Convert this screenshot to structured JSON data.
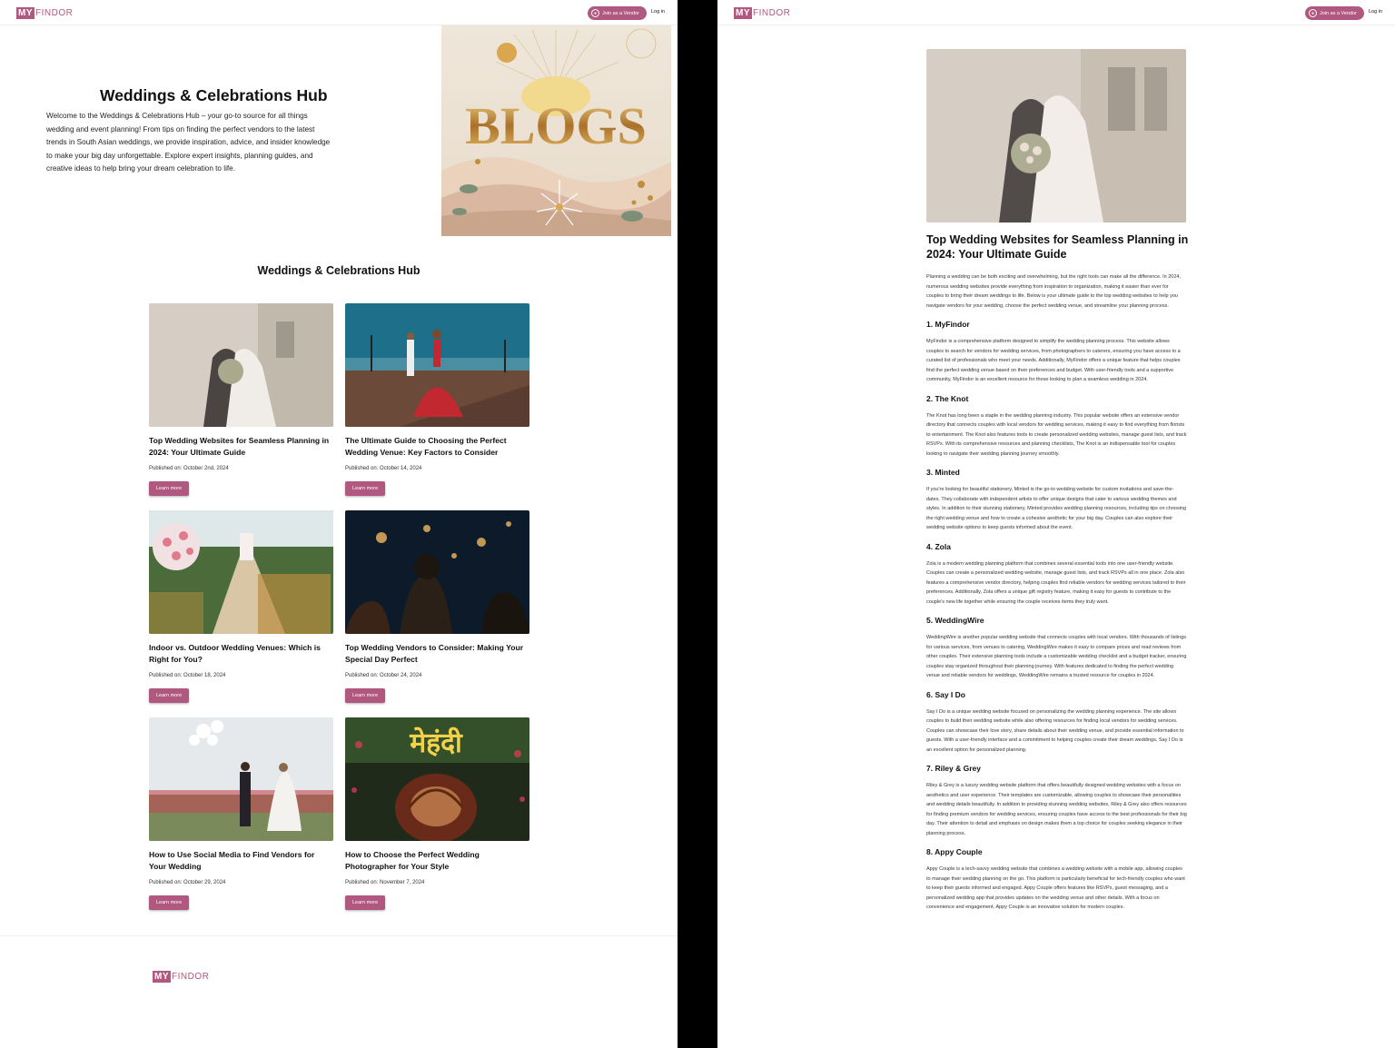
{
  "header": {
    "logo_my": "MY",
    "logo_rest": "FINDOR",
    "vendor_label": "Join as a Vendor",
    "login_label": "Log in"
  },
  "hero": {
    "title": "Weddings & Celebrations Hub",
    "text": "Welcome to the Weddings & Celebrations Hub – your go-to source for all things wedding and event planning! From tips on finding the perfect vendors to the latest trends in South Asian weddings, we provide inspiration, advice, and insider knowledge to make your big day unforgettable. Explore expert insights, planning guides, and creative ideas to help bring your dream celebration to life.",
    "image_word": "BLOGS"
  },
  "section_title": "Weddings & Celebrations Hub",
  "cards": [
    {
      "title": "Top Wedding Websites for Seamless Planning in 2024: Your Ultimate Guide",
      "published": "Published on: October 2nd, 2024",
      "button": "Learn more"
    },
    {
      "title": "The Ultimate Guide to Choosing the Perfect Wedding Venue: Key Factors to Consider",
      "published": "Published on: October 14, 2024",
      "button": "Learn more"
    },
    {
      "title": "Indoor vs. Outdoor Wedding Venues: Which is Right for You?",
      "published": "Published on: October 18, 2024",
      "button": "Learn more"
    },
    {
      "title": "Top Wedding Vendors to Consider: Making Your Special Day Perfect",
      "published": "Published on: October 24, 2024",
      "button": "Learn more"
    },
    {
      "title": "How to Use Social Media to Find Vendors for Your Wedding",
      "published": "Published on: October 29, 2024",
      "button": "Learn more"
    },
    {
      "title": "How to Choose the Perfect Wedding Photographer for Your Style",
      "published": "Published on: November 7, 2024",
      "button": "Learn more"
    }
  ],
  "article": {
    "title": "Top Wedding Websites for Seamless Planning in 2024: Your Ultimate Guide",
    "intro": "Planning a wedding can be both exciting and overwhelming, but the right tools can make all the difference. In 2024, numerous wedding websites provide everything from inspiration to organization, making it easier than ever for couples to bring their dream weddings to life. Below is your ultimate guide to the top wedding websites to help you navigate vendors for your wedding, choose the perfect wedding venue, and streamline your planning process.",
    "sections": [
      {
        "heading": "1. MyFindor",
        "body": "MyFindor is a comprehensive platform designed to simplify the wedding planning process. This website allows couples to search for vendors for wedding services, from photographers to caterers, ensuring you have access to a curated list of professionals who meet your needs. Additionally, MyFindor offers a unique feature that helps couples find the perfect wedding venue based on their preferences and budget. With user-friendly tools and a supportive community, MyFindor is an excellent resource for those looking to plan a seamless wedding in 2024."
      },
      {
        "heading": "2. The Knot",
        "body": "The Knot has long been a staple in the wedding planning industry. This popular website offers an extensive vendor directory that connects couples with local vendors for wedding services, making it easy to find everything from florists to entertainment. The Knot also features tools to create personalized wedding websites, manage guest lists, and track RSVPs. With its comprehensive resources and planning checklists, The Knot is an indispensable tool for couples looking to navigate their wedding planning journey smoothly."
      },
      {
        "heading": "3. Minted",
        "body": "If you're looking for beautiful stationery, Minted is the go-to wedding website for custom invitations and save-the-dates. They collaborate with independent artists to offer unique designs that cater to various wedding themes and styles. In addition to their stunning stationery, Minted provides wedding planning resources, including tips on choosing the right wedding venue and how to create a cohesive aesthetic for your big day. Couples can also explore their wedding website options to keep guests informed about the event."
      },
      {
        "heading": "4. Zola",
        "body": "Zola is a modern wedding planning platform that combines several essential tools into one user-friendly website. Couples can create a personalized wedding website, manage guest lists, and track RSVPs all in one place. Zola also features a comprehensive vendor directory, helping couples find reliable vendors for wedding services tailored to their preferences. Additionally, Zola offers a unique gift registry feature, making it easy for guests to contribute to the couple's new life together while ensuring the couple receives items they truly want."
      },
      {
        "heading": "5. WeddingWire",
        "body": "WeddingWire is another popular wedding website that connects couples with local vendors. With thousands of listings for various services, from venues to catering, WeddingWire makes it easy to compare prices and read reviews from other couples. Their extensive planning tools include a customizable wedding checklist and a budget tracker, ensuring couples stay organized throughout their planning journey. With features dedicated to finding the perfect wedding venue and reliable vendors for weddings, WeddingWire remains a trusted resource for couples in 2024."
      },
      {
        "heading": "6. Say I Do",
        "body": "Say I Do is a unique wedding website focused on personalizing the wedding planning experience. The site allows couples to build their wedding website while also offering resources for finding local vendors for wedding services. Couples can showcase their love story, share details about their wedding venue, and provide essential information to guests. With a user-friendly interface and a commitment to helping couples create their dream weddings, Say I Do is an excellent option for personalized planning."
      },
      {
        "heading": "7. Riley & Grey",
        "body": "Riley & Grey is a luxury wedding website platform that offers beautifully designed wedding websites with a focus on aesthetics and user experience. Their templates are customizable, allowing couples to showcase their personalities and wedding details beautifully. In addition to providing stunning wedding websites, Riley & Grey also offers resources for finding premium vendors for wedding services, ensuring couples have access to the best professionals for their big day. Their attention to detail and emphasis on design makes them a top choice for couples seeking elegance in their planning process."
      },
      {
        "heading": "8. Appy Couple",
        "body": "Appy Couple is a tech-savvy wedding website that combines a wedding website with a mobile app, allowing couples to manage their wedding planning on the go. This platform is particularly beneficial for tech-friendly couples who want to keep their guests informed and engaged. Appy Couple offers features like RSVPs, guest messaging, and a personalized wedding app that provides updates on the wedding venue and other details. With a focus on convenience and engagement, Appy Couple is an innovative solution for modern couples."
      }
    ]
  }
}
